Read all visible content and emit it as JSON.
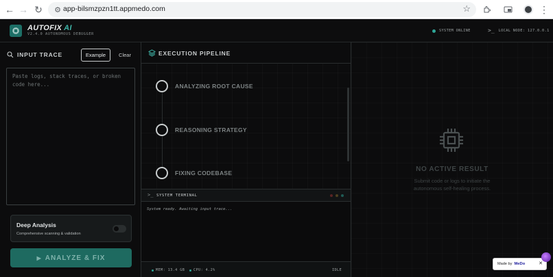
{
  "browser": {
    "url": "app-bilsmzpzn1tt.appmedo.com"
  },
  "header": {
    "brand_main": "AUTOFIX",
    "brand_accent": "AI",
    "version": "V2.4.0 AUTONOMOUS DEBUGGER",
    "system_status": "SYSTEM ONLINE",
    "local_node": "LOCAL NODE: 127.0.0.1"
  },
  "input": {
    "title": "INPUT TRACE",
    "example_label": "Example",
    "clear_label": "Clear",
    "placeholder": "Paste logs, stack traces, or broken code here...",
    "value": ""
  },
  "deep_analysis": {
    "title": "Deep Analysis",
    "subtitle": "Comprehensive scanning & validation",
    "enabled": false
  },
  "analyze_button": {
    "label": "ANALYZE & FIX"
  },
  "pipeline": {
    "title": "EXECUTION PIPELINE",
    "steps": [
      {
        "label": "ANALYZING ROOT CAUSE"
      },
      {
        "label": "REASONING STRATEGY"
      },
      {
        "label": "FIXING CODEBASE"
      }
    ]
  },
  "terminal": {
    "title": "SYSTEM TERMINAL",
    "log_line": "System ready. Awaiting input trace..."
  },
  "status_bar": {
    "mem": "MEM: 13.4 GB",
    "cpu": "CPU: 4.2%",
    "state": "IDLE"
  },
  "result": {
    "title": "NO ACTIVE RESULT",
    "subtitle": "Submit code or logs to initiate the autonomous self-healing process."
  },
  "badge": {
    "made_by": "Made by",
    "brand": "MeDo"
  },
  "colors": {
    "accent": "#2ea597",
    "button": "#1e6a60",
    "background": "#0b0b0c"
  }
}
